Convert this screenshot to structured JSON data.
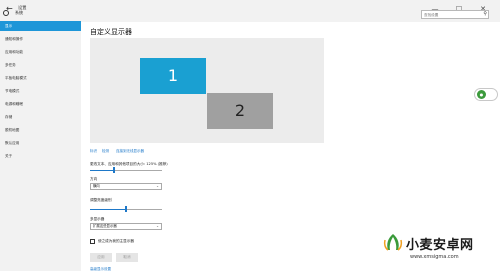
{
  "app": {
    "title": "设置"
  },
  "window": {
    "minimize": "—",
    "maximize": "☐",
    "close": "✕"
  },
  "search": {
    "placeholder": "查找设置"
  },
  "sidebar": {
    "home_label": "系统",
    "items": [
      {
        "label": "显示",
        "active": true
      },
      {
        "label": "通知和操作"
      },
      {
        "label": "应用和功能"
      },
      {
        "label": "多任务"
      },
      {
        "label": "平板电脑模式"
      },
      {
        "label": "节电模式"
      },
      {
        "label": "电源和睡眠"
      },
      {
        "label": "存储"
      },
      {
        "label": "脱机地图"
      },
      {
        "label": "默认应用"
      },
      {
        "label": "关于"
      }
    ]
  },
  "main": {
    "title": "自定义显示器",
    "monitors": [
      "1",
      "2"
    ],
    "links": {
      "identify": "标识",
      "detect": "检测",
      "wireless": "连接到无线显示器"
    },
    "scale_label": "更改文本、应用和其他项目的大小: 125% (推荐)",
    "scale_value_fraction": 0.33,
    "orientation_label": "方向",
    "orientation_value": "横向",
    "brightness_label": "调整亮度级别",
    "brightness_value_fraction": 0.5,
    "multi_display_label": "多显示器",
    "multi_display_value": "扩展这些显示器",
    "main_display_checkbox": "使之成为我的主显示器",
    "apply_button": "应用",
    "cancel_button": "取消",
    "advanced_link": "高级显示设置"
  },
  "watermark": {
    "name": "小麦安卓网",
    "url": "www.xmsigma.com"
  },
  "colors": {
    "accent": "#1e96d8",
    "monitor_selected": "#1aa0d2",
    "monitor_other": "#a0a0a0"
  }
}
